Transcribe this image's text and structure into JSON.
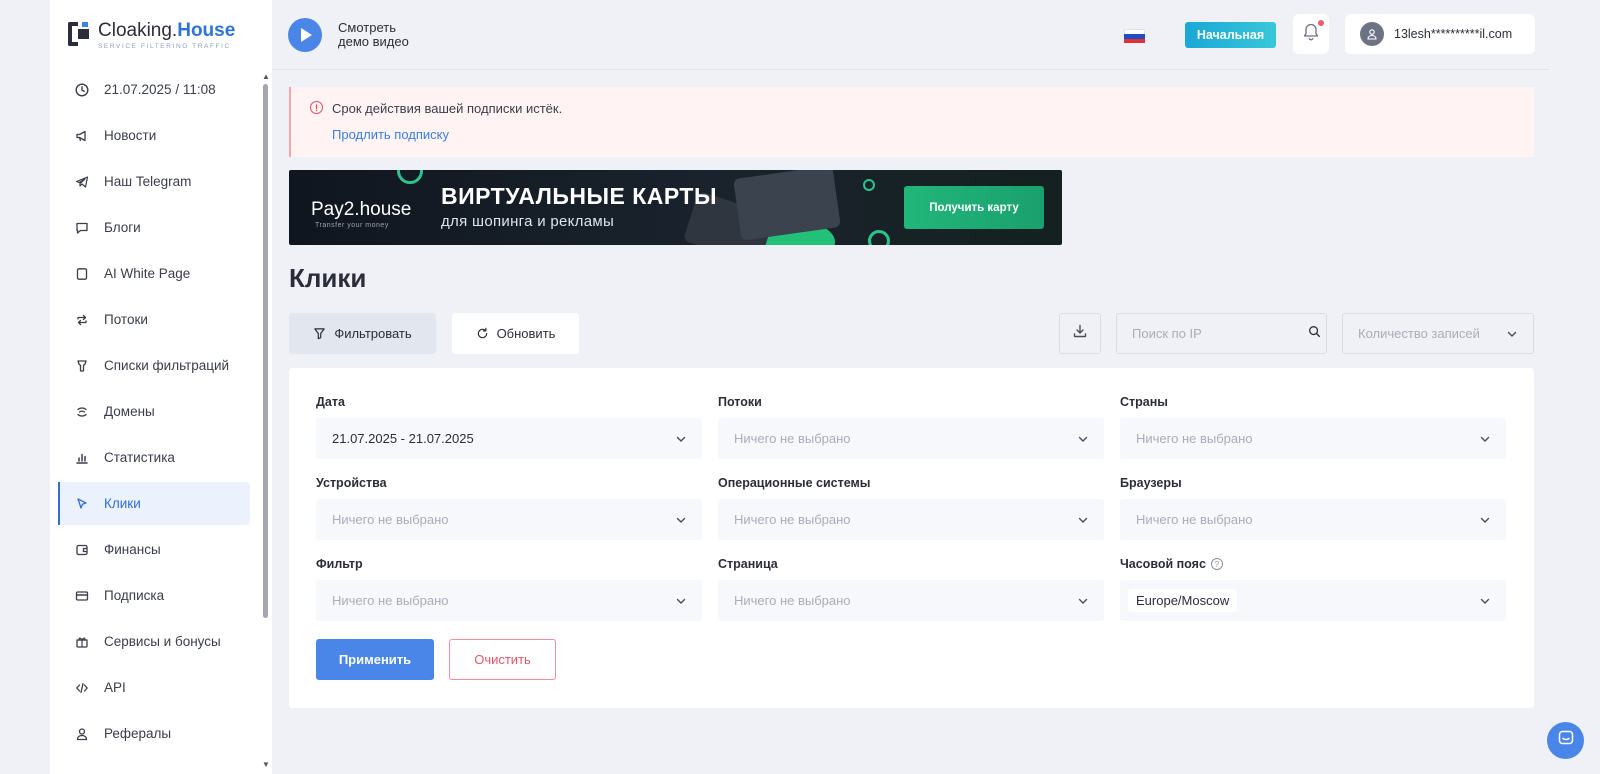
{
  "brand": {
    "name_part1": "Cloaking.",
    "name_part2": "House",
    "tagline": "SERVICE FILTERING TRAFFIC"
  },
  "sidebar": {
    "items": [
      {
        "label": "21.07.2025 / 11:08",
        "icon": "clock-icon"
      },
      {
        "label": "Новости",
        "icon": "megaphone-icon"
      },
      {
        "label": "Наш Telegram",
        "icon": "telegram-icon"
      },
      {
        "label": "Блоги",
        "icon": "chat-icon"
      },
      {
        "label": "AI White Page",
        "icon": "page-icon"
      },
      {
        "label": "Потоки",
        "icon": "repeat-icon"
      },
      {
        "label": "Списки фильтраций",
        "icon": "filter-icon"
      },
      {
        "label": "Домены",
        "icon": "domain-icon"
      },
      {
        "label": "Статистика",
        "icon": "bar-chart-icon"
      },
      {
        "label": "Клики",
        "icon": "cursor-icon",
        "active": true
      },
      {
        "label": "Финансы",
        "icon": "wallet-icon"
      },
      {
        "label": "Подписка",
        "icon": "card-icon"
      },
      {
        "label": "Сервисы и бонусы",
        "icon": "gift-icon"
      },
      {
        "label": "API",
        "icon": "code-icon"
      },
      {
        "label": "Рефералы",
        "icon": "user-icon"
      }
    ]
  },
  "header": {
    "demo_line1": "Смотреть",
    "demo_line2": "демо видео",
    "language": "RU",
    "plan_badge": "Начальная",
    "user_email": "13lesh**********il.com"
  },
  "alert": {
    "message": "Срок действия вашей подписки истёк.",
    "link": "Продлить подписку"
  },
  "banner": {
    "logo": "Pay2.house",
    "logo_sub": "Transfer your money",
    "title": "ВИРТУАЛЬНЫЕ КАРТЫ",
    "subtitle": "для шопинга и рекламы",
    "cta": "Получить карту"
  },
  "page": {
    "title": "Клики"
  },
  "toolbar": {
    "filter_label": "Фильтровать",
    "refresh_label": "Обновить",
    "search_placeholder": "Поиск по IP",
    "count_placeholder": "Количество записей"
  },
  "filters": {
    "date": {
      "label": "Дата",
      "value": "21.07.2025 - 21.07.2025"
    },
    "streams": {
      "label": "Потоки",
      "value": "Ничего не выбрано"
    },
    "countries": {
      "label": "Страны",
      "value": "Ничего не выбрано"
    },
    "devices": {
      "label": "Устройства",
      "value": "Ничего не выбрано"
    },
    "os": {
      "label": "Операционные системы",
      "value": "Ничего не выбрано"
    },
    "browsers": {
      "label": "Браузеры",
      "value": "Ничего не выбрано"
    },
    "filter": {
      "label": "Фильтр",
      "value": "Ничего не выбрано"
    },
    "page": {
      "label": "Страница",
      "value": "Ничего не выбрано"
    },
    "timezone": {
      "label": "Часовой пояс",
      "value": "Europe/Moscow",
      "help": "?"
    },
    "apply_label": "Применить",
    "clear_label": "Очистить"
  },
  "colors": {
    "accent": "#4a86e8",
    "danger": "#e4576a",
    "badge": "#1aa7d6",
    "banner_cta": "#22b67a"
  }
}
